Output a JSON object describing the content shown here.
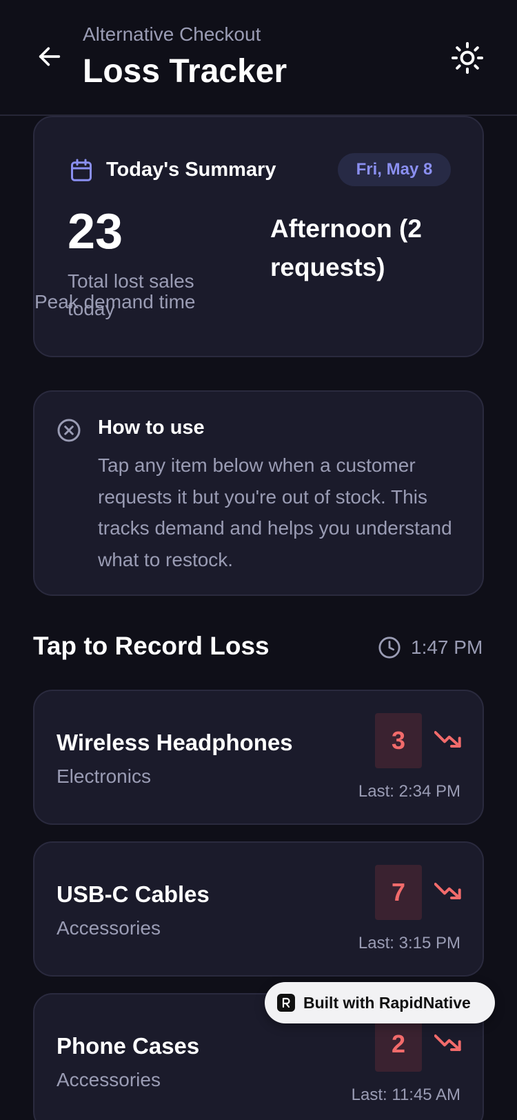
{
  "header": {
    "subtitle": "Alternative Checkout",
    "title": "Loss Tracker"
  },
  "summary": {
    "title": "Today's Summary",
    "date": "Fri, May 8",
    "total": "23",
    "total_label": "Total lost sales today",
    "peak": "Afternoon (2 requests)",
    "peak_label": "Peak demand time"
  },
  "howto": {
    "title": "How to use",
    "text": "Tap any item below when a customer requests it but you're out of stock. This tracks demand and helps you understand what to restock."
  },
  "section": {
    "title": "Tap to Record Loss",
    "time": "1:47 PM"
  },
  "items": [
    {
      "name": "Wireless Headphones",
      "category": "Electronics",
      "count": "3",
      "last": "Last: 2:34 PM"
    },
    {
      "name": "USB-C Cables",
      "category": "Accessories",
      "count": "7",
      "last": "Last: 3:15 PM"
    },
    {
      "name": "Phone Cases",
      "category": "Accessories",
      "count": "2",
      "last": "Last: 11:45 AM"
    }
  ],
  "badge": {
    "label": "Built with RapidNative"
  },
  "colors": {
    "background": "#0f0f18",
    "card": "#1b1b2b",
    "accent": "#8a8ff0",
    "loss_red": "#f26b6b"
  },
  "icons": {
    "back": "arrow-left-icon",
    "theme": "sun-icon",
    "calendar": "calendar-icon",
    "info": "close-circle-icon",
    "clock": "clock-icon",
    "trend": "trending-down-icon"
  }
}
